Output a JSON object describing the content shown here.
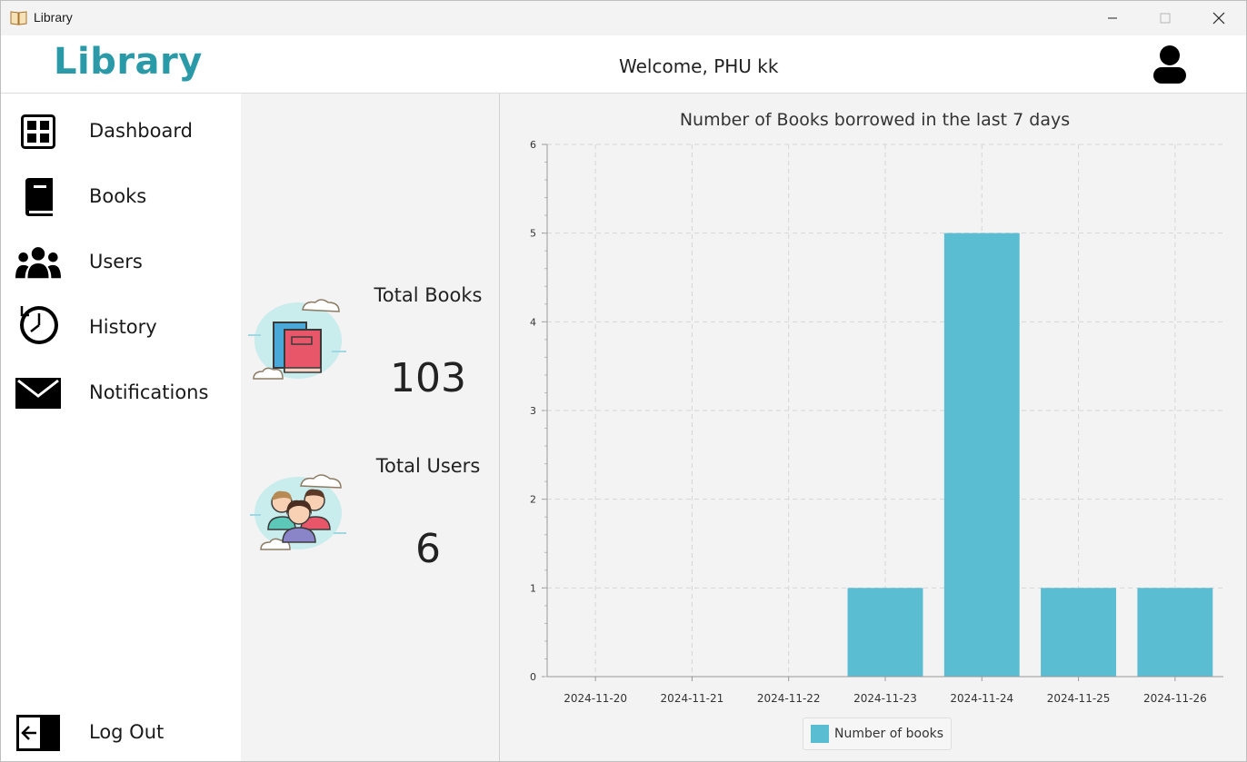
{
  "window": {
    "title": "Library"
  },
  "header": {
    "logo": "Library",
    "welcome": "Welcome, PHU kk"
  },
  "sidebar": {
    "items": [
      {
        "label": "Dashboard",
        "icon": "dashboard-icon"
      },
      {
        "label": "Books",
        "icon": "book-icon"
      },
      {
        "label": "Users",
        "icon": "users-icon"
      },
      {
        "label": "History",
        "icon": "history-icon"
      },
      {
        "label": "Notifications",
        "icon": "mail-icon"
      }
    ],
    "logout": {
      "label": "Log Out",
      "icon": "logout-icon"
    }
  },
  "stats": {
    "books": {
      "label": "Total Books",
      "value": "103"
    },
    "users": {
      "label": "Total Users",
      "value": "6"
    }
  },
  "colors": {
    "accent": "#2a9aa9",
    "bar": "#5bbdd2",
    "panel": "#f3f3f3"
  },
  "chart_data": {
    "type": "bar",
    "title": "Number of Books borrowed in the last 7 days",
    "categories": [
      "2024-11-20",
      "2024-11-21",
      "2024-11-22",
      "2024-11-23",
      "2024-11-24",
      "2024-11-25",
      "2024-11-26"
    ],
    "series": [
      {
        "name": "Number of books",
        "values": [
          0,
          0,
          0,
          1,
          5,
          1,
          1
        ]
      }
    ],
    "ylim": [
      0,
      6
    ],
    "yticks": [
      0,
      1,
      2,
      3,
      4,
      5,
      6
    ],
    "grid": true,
    "legend": "bottom"
  }
}
